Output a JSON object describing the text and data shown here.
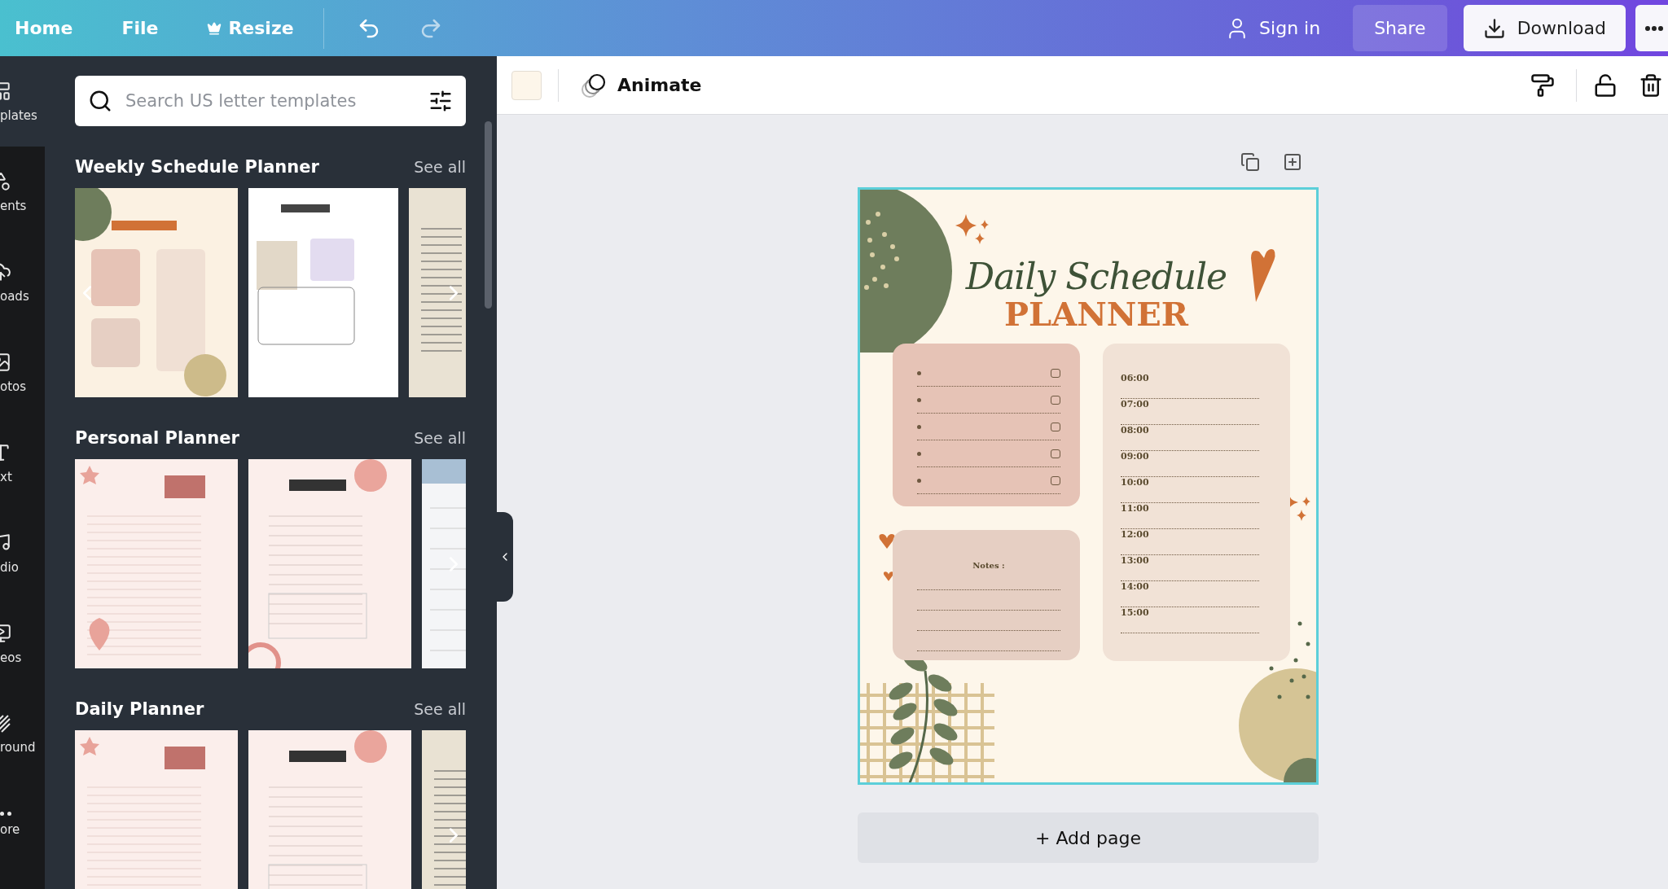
{
  "topbar": {
    "menu": [
      {
        "label": "Home",
        "kind": "plain"
      },
      {
        "label": "File",
        "kind": "plain"
      },
      {
        "label": "Resize",
        "kind": "crown"
      }
    ],
    "sign_in": "Sign in",
    "share": "Share",
    "download": "Download"
  },
  "rail": [
    {
      "label": "plates",
      "kind": "template",
      "selected": true
    },
    {
      "label": "ents",
      "kind": "shapes",
      "selected": false
    },
    {
      "label": "oads",
      "kind": "upload",
      "selected": false
    },
    {
      "label": "otos",
      "kind": "image",
      "selected": false
    },
    {
      "label": "xt",
      "kind": "text",
      "selected": false
    },
    {
      "label": "dio",
      "kind": "music",
      "selected": false
    },
    {
      "label": "eos",
      "kind": "video",
      "selected": false
    },
    {
      "label": "round",
      "kind": "stripes",
      "selected": false
    },
    {
      "label": "ore",
      "kind": "more",
      "selected": false
    }
  ],
  "search": {
    "placeholder": "Search US letter templates"
  },
  "sections": [
    {
      "title": "Weekly Schedule Planner",
      "see_all": "See all",
      "scroll_back": true,
      "thumbnails": [
        {
          "kind": "planner"
        },
        {
          "kind": "agenda"
        },
        {
          "kind": "daily"
        }
      ]
    },
    {
      "title": "Personal Planner",
      "see_all": "See all",
      "scroll_back": false,
      "thumbnails": [
        {
          "kind": "notes"
        },
        {
          "kind": "notes2"
        },
        {
          "kind": "weekly"
        }
      ]
    },
    {
      "title": "Daily Planner",
      "see_all": "See all",
      "scroll_back": false,
      "thumbnails": [
        {
          "kind": "notes"
        },
        {
          "kind": "notes2"
        },
        {
          "kind": "daily"
        }
      ]
    }
  ],
  "toolbar": {
    "animate": "Animate"
  },
  "document": {
    "title_script": "Daily Schedule",
    "title": "PLANNER",
    "todo": [
      {
        "checked": false
      },
      {
        "checked": false
      },
      {
        "checked": false
      },
      {
        "checked": false
      },
      {
        "checked": false
      }
    ],
    "times": [
      "06:00",
      "07:00",
      "08:00",
      "09:00",
      "10:00",
      "11:00",
      "12:00",
      "13:00",
      "14:00",
      "15:00"
    ],
    "notes_label": "Notes :"
  },
  "add_page": "+ Add page"
}
